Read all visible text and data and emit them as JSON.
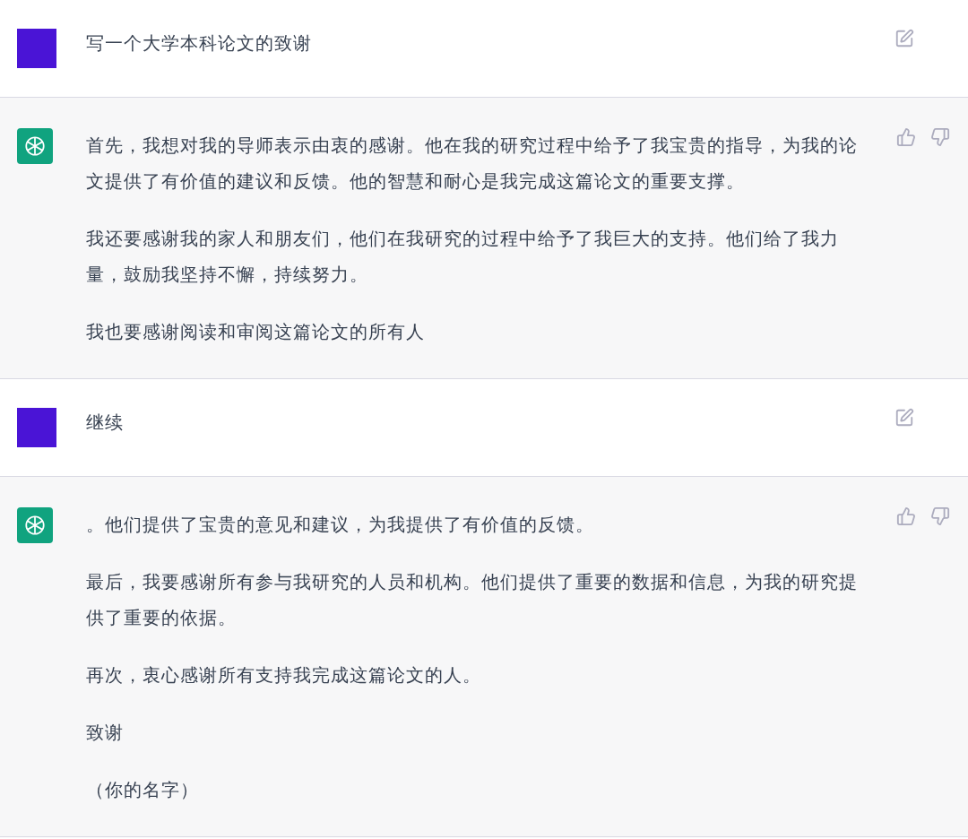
{
  "messages": [
    {
      "kind": "user",
      "paragraphs": [
        "写一个大学本科论文的致谢"
      ]
    },
    {
      "kind": "assistant",
      "paragraphs": [
        "首先，我想对我的导师表示由衷的感谢。他在我的研究过程中给予了我宝贵的指导，为我的论文提供了有价值的建议和反馈。他的智慧和耐心是我完成这篇论文的重要支撑。",
        "我还要感谢我的家人和朋友们，他们在我研究的过程中给予了我巨大的支持。他们给了我力量，鼓励我坚持不懈，持续努力。",
        "我也要感谢阅读和审阅这篇论文的所有人"
      ]
    },
    {
      "kind": "user",
      "paragraphs": [
        "继续"
      ]
    },
    {
      "kind": "assistant",
      "paragraphs": [
        "。他们提供了宝贵的意见和建议，为我提供了有价值的反馈。",
        "最后，我要感谢所有参与我研究的人员和机构。他们提供了重要的数据和信息，为我的研究提供了重要的依据。",
        "再次，衷心感谢所有支持我完成这篇论文的人。",
        "致谢",
        "（你的名字）"
      ]
    }
  ]
}
